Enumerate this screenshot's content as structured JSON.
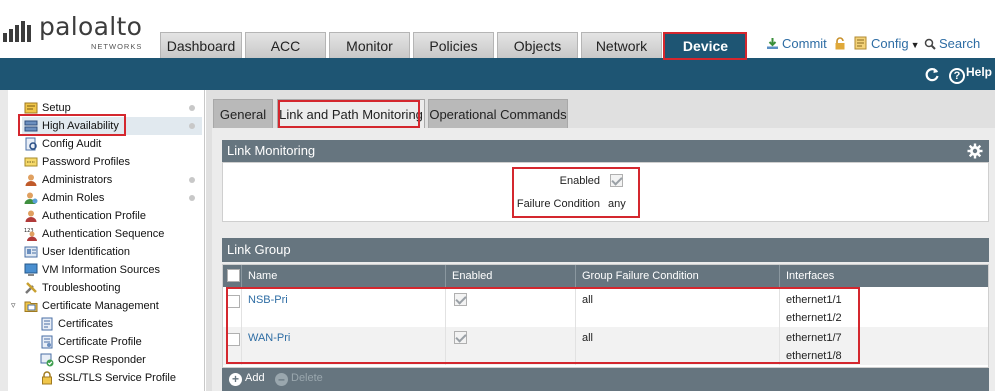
{
  "logo": {
    "name": "paloalto",
    "sub": "NETWORKS"
  },
  "top_tabs": [
    {
      "label": "Dashboard"
    },
    {
      "label": "ACC"
    },
    {
      "label": "Monitor"
    },
    {
      "label": "Policies"
    },
    {
      "label": "Objects"
    },
    {
      "label": "Network"
    },
    {
      "label": "Device",
      "active": true
    }
  ],
  "top_links": {
    "commit": "Commit",
    "config": "Config",
    "search": "Search"
  },
  "bluebar": {
    "help": "Help"
  },
  "nav": [
    {
      "label": "Setup",
      "dot": true
    },
    {
      "label": "High Availability",
      "selected": true,
      "dot": true
    },
    {
      "label": "Config Audit"
    },
    {
      "label": "Password Profiles"
    },
    {
      "label": "Administrators",
      "dot": true
    },
    {
      "label": "Admin Roles",
      "dot": true
    },
    {
      "label": "Authentication Profile"
    },
    {
      "label": "Authentication Sequence"
    },
    {
      "label": "User Identification"
    },
    {
      "label": "VM Information Sources"
    },
    {
      "label": "Troubleshooting"
    },
    {
      "label": "Certificate Management",
      "expanded": true
    },
    {
      "label": "Certificates",
      "child": true
    },
    {
      "label": "Certificate Profile",
      "child": true
    },
    {
      "label": "OCSP Responder",
      "child": true
    },
    {
      "label": "SSL/TLS Service Profile",
      "child": true
    }
  ],
  "sub_tabs": [
    {
      "label": "General"
    },
    {
      "label": "Link and Path Monitoring",
      "active": true
    },
    {
      "label": "Operational Commands"
    }
  ],
  "link_monitoring": {
    "title": "Link Monitoring",
    "enabled_label": "Enabled",
    "enabled": true,
    "failure_label": "Failure Condition",
    "failure_value": "any"
  },
  "link_group": {
    "title": "Link Group",
    "columns": [
      "Name",
      "Enabled",
      "Group Failure Condition",
      "Interfaces"
    ],
    "rows": [
      {
        "name": "NSB-Pri",
        "enabled": true,
        "condition": "all",
        "interfaces": [
          "ethernet1/1",
          "ethernet1/2"
        ]
      },
      {
        "name": "WAN-Pri",
        "enabled": true,
        "condition": "all",
        "interfaces": [
          "ethernet1/7",
          "ethernet1/8"
        ]
      }
    ],
    "add_label": "Add",
    "delete_label": "Delete"
  },
  "colors": {
    "brand_blue": "#1e5573",
    "header_gray": "#66757f",
    "annotation_red": "#d4272e",
    "link_blue": "#2e6da4"
  }
}
